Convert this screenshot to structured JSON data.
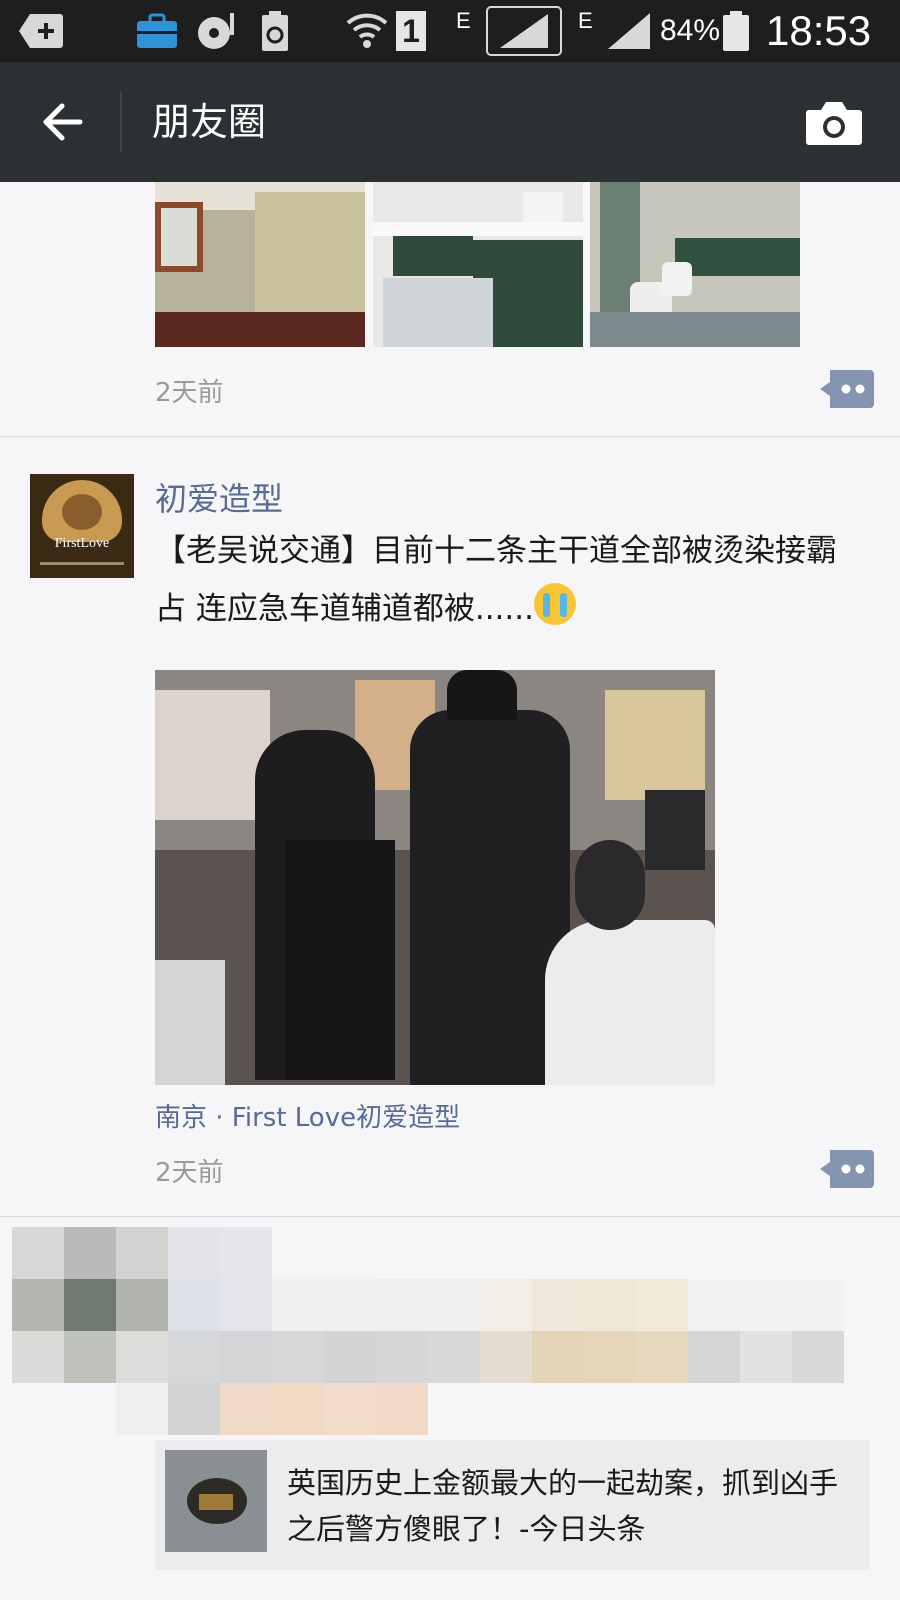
{
  "status_bar": {
    "sim_badge": "1",
    "network_1": "E",
    "network_2": "E",
    "battery_percent": "84%",
    "time": "18:53"
  },
  "header": {
    "title": "朋友圈"
  },
  "posts": [
    {
      "timestamp": "2天前"
    },
    {
      "author": "初爱造型",
      "avatar_text": "FirstLove",
      "text": "【老吴说交通】目前十二条主干道全部被烫染接霸占 连应急车道辅道都被......",
      "location": "南京 · First Love初爱造型",
      "timestamp": "2天前"
    },
    {
      "share_title": "英国历史上金额最大的一起劫案，抓到凶手之后警方傻眼了！-今日头条"
    }
  ],
  "colors": {
    "link": "#576b95",
    "header_bg": "#2b3033",
    "status_bg": "#1e1e1e",
    "background": "#f6f6f8"
  }
}
